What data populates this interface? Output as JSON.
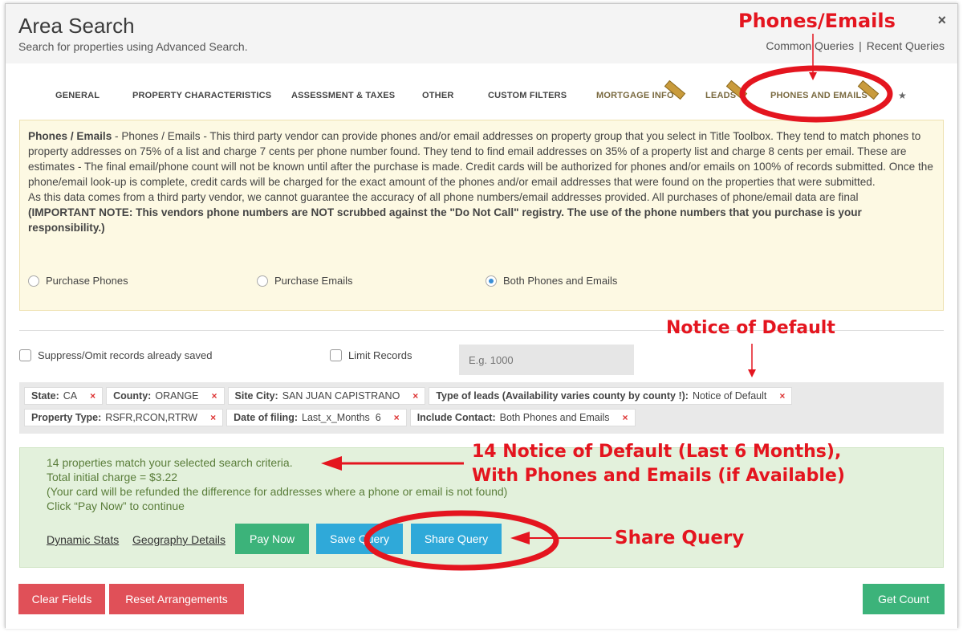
{
  "modal": {
    "title": "Area Search",
    "subtitle": "Search for properties using Advanced Search.",
    "close_label": "×",
    "common_queries": "Common Queries",
    "separator": "|",
    "recent_queries": "Recent Queries"
  },
  "tabs": [
    {
      "label": "GENERAL"
    },
    {
      "label": "PROPERTY CHARACTERISTICS"
    },
    {
      "label": "ASSESSMENT & TAXES"
    },
    {
      "label": "OTHER"
    },
    {
      "label": "CUSTOM FILTERS"
    },
    {
      "label": "MORTGAGE INFO"
    },
    {
      "label": "LEADS"
    },
    {
      "label": "PHONES AND EMAILS"
    }
  ],
  "star": "★",
  "vendor": {
    "heading": "Phones / Emails",
    "text1": " - Phones / Emails - This third party vendor can provide phones and/or email addresses on property group that you select in Title Toolbox. They tend to match phones to property addresses on 75% of a list and charge 7 cents per phone number found. They tend to find email addresses on 35% of a property list and charge 8 cents per email. These are estimates - The final email/phone count will not be known until after the purchase is made. Credit cards will be authorized for phones and/or emails on 100% of records submitted. Once the phone/email look-up is complete, credit cards will be charged for the exact amount of the phones and/or email addresses that were found on the properties that were submitted.",
    "text2": "As this data comes from a third party vendor, we cannot guarantee the accuracy of all phone numbers/email addresses provided. All purchases of phone/email data are final",
    "important": "(IMPORTANT NOTE: This vendors phone numbers are NOT scrubbed against the \"Do Not Call\" registry. The use of the phone numbers that you purchase is your responsibility.)",
    "options": [
      {
        "label": "Purchase Phones",
        "selected": false
      },
      {
        "label": "Purchase Emails",
        "selected": false
      },
      {
        "label": "Both Phones and Emails",
        "selected": true
      }
    ]
  },
  "options": {
    "suppress_label": "Suppress/Omit records already saved",
    "limit_label": "Limit Records",
    "limit_placeholder": "E.g. 1000"
  },
  "criteria": {
    "row1": [
      {
        "key": "State:",
        "value": "CA"
      },
      {
        "key": "County:",
        "value": "ORANGE"
      },
      {
        "key": "Site City:",
        "value": "SAN JUAN CAPISTRANO"
      },
      {
        "key": "Type of leads (Availability varies county by county !):",
        "value": "Notice of Default"
      }
    ],
    "row2": [
      {
        "key": "Property Type:",
        "value": "RSFR,RCON,RTRW"
      },
      {
        "key": "Date of filing:",
        "value": "Last_x_Months  6"
      },
      {
        "key": "Include Contact:",
        "value": "Both Phones and Emails"
      }
    ],
    "remove_label": "×"
  },
  "results": {
    "line1": "14 properties match your selected search criteria.",
    "line2": "Total initial charge = $3.22",
    "line3": "(Your card will be refunded the difference for addresses where a phone or email is not found)",
    "line4": "Click “Pay Now” to continue",
    "dynamic_stats": "Dynamic Stats",
    "geography_details": "Geography Details",
    "pay_now": "Pay Now",
    "save_query": "Save Query",
    "share_query": "Share Query"
  },
  "footer": {
    "clear_fields": "Clear Fields",
    "reset_arrangements": "Reset Arrangements",
    "get_count": "Get Count"
  },
  "annotations": {
    "phones_emails": "Phones/Emails",
    "notice_of_default": "Notice of Default",
    "summary_line1": "14 Notice of Default (Last 6 Months),",
    "summary_line2": "With Phones and Emails (if Available)",
    "share_query": "Share Query",
    "color": "#e4151f"
  },
  "colors": {
    "green_button": "#3cb37a",
    "blue_button": "#2fa9d9",
    "red_button": "#e05058",
    "vendor_bg": "#fdf9e3",
    "results_bg": "#e3f1dc"
  }
}
